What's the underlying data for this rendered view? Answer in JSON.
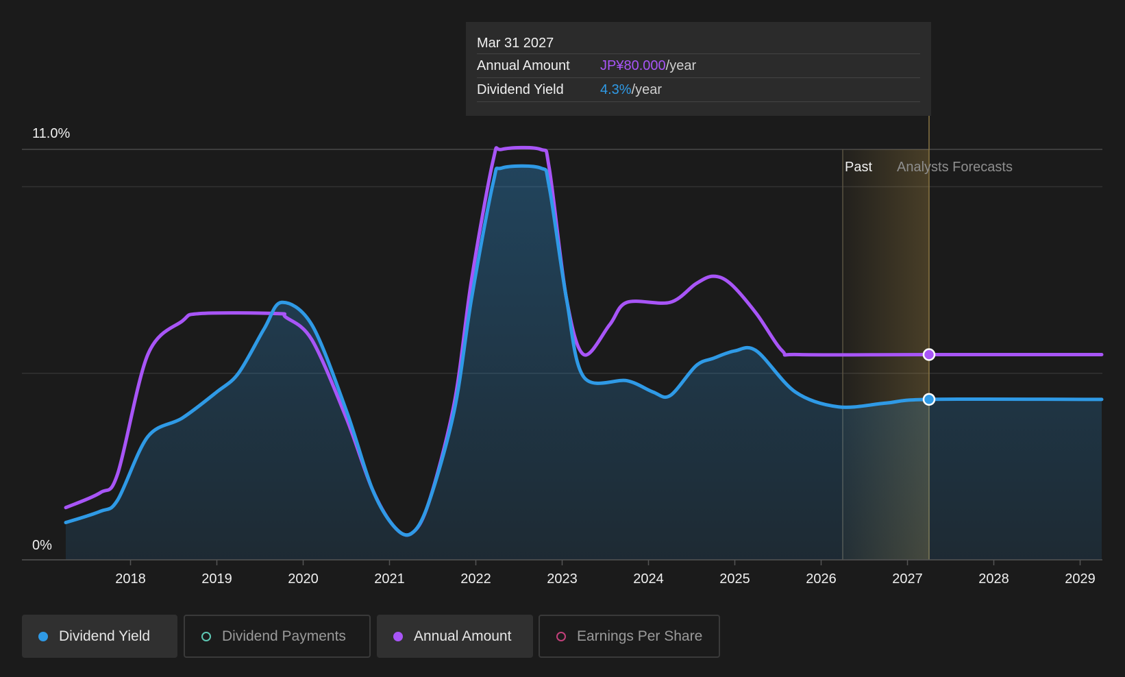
{
  "tooltip": {
    "date": "Mar 31 2027",
    "rows": [
      {
        "label": "Annual Amount",
        "value": "JP¥80.000",
        "unit": "/year"
      },
      {
        "label": "Dividend Yield",
        "value": "4.3%",
        "unit": "/year"
      }
    ]
  },
  "regions": {
    "past": "Past",
    "forecast": "Analysts Forecasts"
  },
  "legend": [
    {
      "label": "Dividend Yield",
      "active": true,
      "color": "#2f9ae6",
      "filled": true
    },
    {
      "label": "Dividend Payments",
      "active": false,
      "color": "#5ec8b4",
      "filled": false
    },
    {
      "label": "Annual Amount",
      "active": true,
      "color": "#a855f7",
      "filled": true
    },
    {
      "label": "Earnings Per Share",
      "active": false,
      "color": "#c2407a",
      "filled": false
    }
  ],
  "colors": {
    "yield": "#2f9ae6",
    "amount": "#a855f7",
    "background": "#1b1b1b",
    "forecast_band": "#c9a24a"
  },
  "chart_data": {
    "type": "line",
    "y_axis": {
      "min": 0,
      "max": 11.0,
      "unit": "%",
      "tick_labels": [
        "11.0%",
        "0%"
      ]
    },
    "x_axis": {
      "min": 2017.25,
      "max": 2029.25,
      "tick_labels": [
        "2018",
        "2019",
        "2020",
        "2021",
        "2022",
        "2023",
        "2024",
        "2025",
        "2026",
        "2027",
        "2028",
        "2029"
      ]
    },
    "past_until": 2026.25,
    "forecast_marker": 2027.25,
    "series": [
      {
        "name": "Dividend Yield",
        "color": "#2f9ae6",
        "x": [
          2017.25,
          2017.65,
          2017.85,
          2018.2,
          2018.6,
          2019.0,
          2019.25,
          2019.55,
          2019.75,
          2020.1,
          2020.5,
          2020.8,
          2021.05,
          2021.25,
          2021.45,
          2021.75,
          2021.95,
          2022.2,
          2022.3,
          2022.75,
          2022.85,
          2023.05,
          2023.25,
          2023.75,
          2024.05,
          2024.25,
          2024.55,
          2024.75,
          2025.0,
          2025.25,
          2025.7,
          2026.2,
          2026.75,
          2027.25,
          2029.25
        ],
        "y": [
          1.0,
          1.3,
          1.6,
          3.3,
          3.8,
          4.5,
          5.0,
          6.2,
          6.9,
          6.3,
          4.0,
          1.9,
          0.9,
          0.7,
          1.5,
          4.0,
          7.0,
          10.1,
          10.5,
          10.5,
          10.0,
          7.0,
          4.9,
          4.8,
          4.5,
          4.4,
          5.2,
          5.4,
          5.6,
          5.6,
          4.5,
          4.1,
          4.2,
          4.3,
          4.3
        ]
      },
      {
        "name": "Annual Amount",
        "color": "#a855f7",
        "x": [
          2017.25,
          2017.65,
          2017.85,
          2018.2,
          2018.6,
          2018.8,
          2019.7,
          2019.8,
          2020.1,
          2020.5,
          2020.8,
          2021.05,
          2021.25,
          2021.45,
          2021.75,
          2021.95,
          2022.2,
          2022.3,
          2022.75,
          2022.85,
          2023.05,
          2023.25,
          2023.55,
          2023.75,
          2024.25,
          2024.55,
          2024.75,
          2024.95,
          2025.25,
          2025.55,
          2025.75,
          2027.25,
          2029.25
        ],
        "y": [
          1.4,
          1.8,
          2.3,
          5.5,
          6.4,
          6.6,
          6.6,
          6.5,
          5.9,
          3.8,
          1.9,
          0.9,
          0.7,
          1.5,
          4.2,
          7.5,
          10.7,
          11.0,
          11.0,
          10.5,
          7.0,
          5.5,
          6.3,
          6.9,
          6.9,
          7.4,
          7.6,
          7.4,
          6.6,
          5.6,
          5.5,
          5.5,
          5.5
        ]
      }
    ]
  }
}
